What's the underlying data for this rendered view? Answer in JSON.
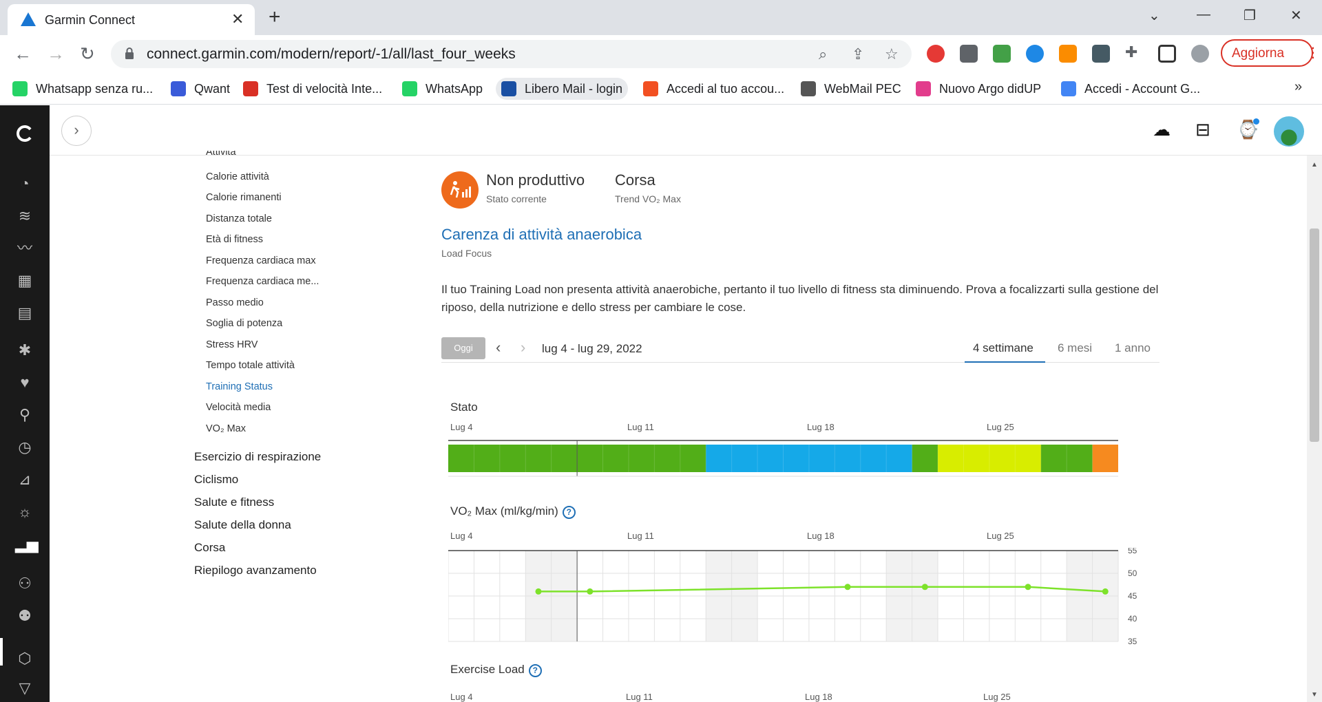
{
  "browser": {
    "tab_title": "Garmin Connect",
    "url": "connect.garmin.com/modern/report/-1/all/last_four_weeks",
    "update_label": "Aggiorna",
    "bookmarks": [
      {
        "label": "Whatsapp senza ru...",
        "color": "#25d366"
      },
      {
        "label": "Qwant",
        "color": "#3a5bd9"
      },
      {
        "label": "Test di velocità Inte...",
        "color": "#d93025"
      },
      {
        "label": "WhatsApp",
        "color": "#25d366"
      },
      {
        "label": "Libero Mail - login",
        "color": "#1a4fa3"
      },
      {
        "label": "Accedi al tuo accou...",
        "color": "#f25022"
      },
      {
        "label": "WebMail PEC",
        "color": "#555555"
      },
      {
        "label": "Nuovo Argo didUP",
        "color": "#e23c8c"
      },
      {
        "label": "Accedi - Account G...",
        "color": "#4285f4"
      }
    ]
  },
  "sidebar": {
    "sub_items": [
      "Attività",
      "Calorie attività",
      "Calorie rimanenti",
      "Distanza totale",
      "Età di fitness",
      "Frequenza cardiaca max",
      "Frequenza cardiaca me...",
      "Passo medio",
      "Soglia di potenza",
      "Stress HRV",
      "Tempo totale attività",
      "Training Status",
      "Velocità media",
      "VO₂ Max"
    ],
    "main_items": [
      "Esercizio di respirazione",
      "Ciclismo",
      "Salute e fitness",
      "Salute della donna",
      "Corsa",
      "Riepilogo avanzamento"
    ]
  },
  "status": {
    "title": "Non produttivo",
    "subtitle": "Stato corrente",
    "trend_title": "Corsa",
    "trend_subtitle": "Trend VO₂ Max",
    "focus_title": "Carenza di attività anaerobica",
    "focus_subtitle": "Load Focus",
    "description": "Il tuo Training Load non presenta attività anaerobiche, pertanto il tuo livello di fitness sta diminuendo. Prova a focalizzarti sulla gestione del riposo, della nutrizione e dello stress per cambiare le cose."
  },
  "controls": {
    "today": "Oggi",
    "date_range": "lug 4 - lug 29, 2022",
    "periods": [
      "4 settimane",
      "6 mesi",
      "1 anno"
    ],
    "active_period": "4 settimane"
  },
  "charts": {
    "stato_title": "Stato",
    "vo2_title": "VO₂ Max (ml/kg/min)",
    "exercise_title": "Exercise Load",
    "week_labels": [
      "Lug 4",
      "Lug 11",
      "Lug 18",
      "Lug 25"
    ]
  },
  "chart_data": [
    {
      "type": "bar",
      "title": "Stato",
      "segments": [
        {
          "from_day": 0,
          "to_day": 10,
          "color": "#52ae18"
        },
        {
          "from_day": 10,
          "to_day": 18,
          "color": "#15a9e8"
        },
        {
          "from_day": 18,
          "to_day": 19,
          "color": "#52ae18"
        },
        {
          "from_day": 19,
          "to_day": 23,
          "color": "#d8ed00"
        },
        {
          "from_day": 23,
          "to_day": 25,
          "color": "#52ae18"
        },
        {
          "from_day": 25,
          "to_day": 26,
          "color": "#f68a1f"
        }
      ]
    },
    {
      "type": "line",
      "title": "VO₂ Max (ml/kg/min)",
      "x_day": [
        3.5,
        5.5,
        15.5,
        18.5,
        22.5,
        25.5
      ],
      "y": [
        46,
        46,
        47,
        47,
        47,
        46
      ],
      "ylim": [
        35,
        55
      ],
      "yticks": [
        55,
        50,
        45,
        40,
        35
      ],
      "color": "#7de22a"
    }
  ]
}
